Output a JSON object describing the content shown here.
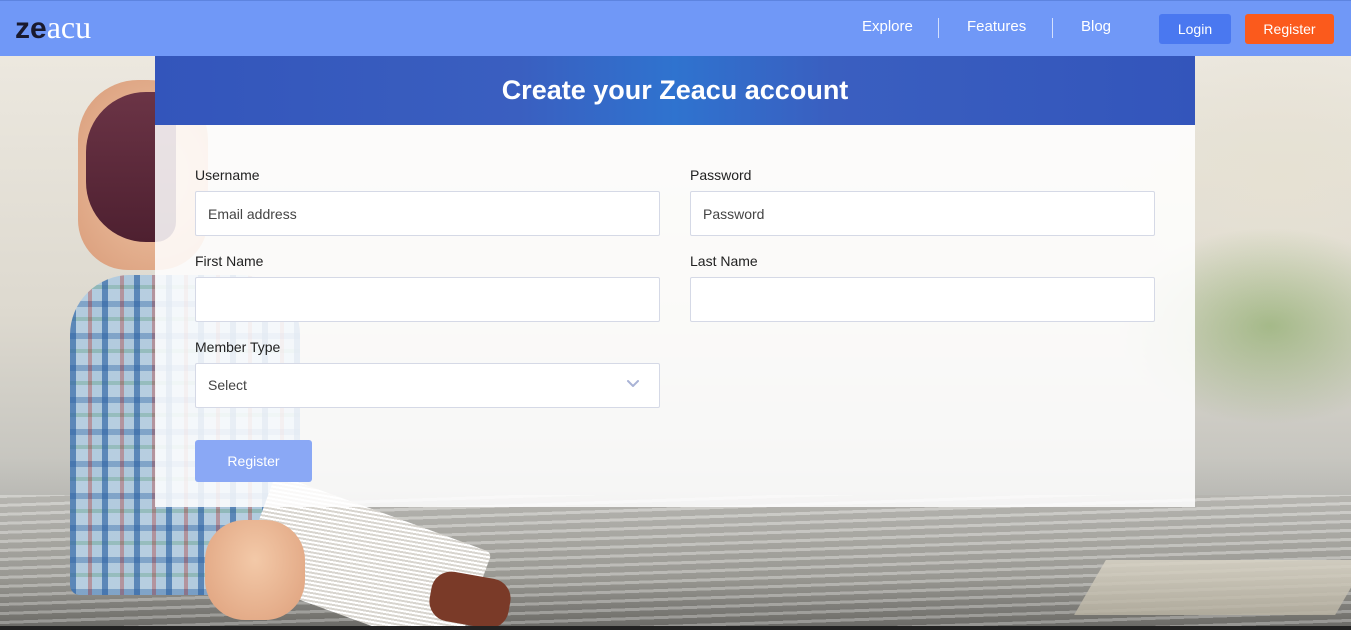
{
  "nav": {
    "logo_part1": "ze",
    "logo_part2": "acu",
    "links": [
      "Explore",
      "Features",
      "Blog"
    ],
    "login_label": "Login",
    "register_label": "Register"
  },
  "form": {
    "title": "Create your Zeacu account",
    "username_label": "Username",
    "username_placeholder": "Email address",
    "password_label": "Password",
    "password_placeholder": "Password",
    "first_name_label": "First Name",
    "first_name_value": "",
    "last_name_label": "Last Name",
    "last_name_value": "",
    "member_type_label": "Member Type",
    "member_type_selected": "Select",
    "submit_label": "Register"
  },
  "colors": {
    "navbar": "#7098f7",
    "login_button": "#4a78f0",
    "register_button": "#fb5a1c",
    "card_header": "#3355bb",
    "submit_button": "#8aa8f5"
  },
  "icons": {
    "select_chevron": "chevron-down-icon"
  }
}
